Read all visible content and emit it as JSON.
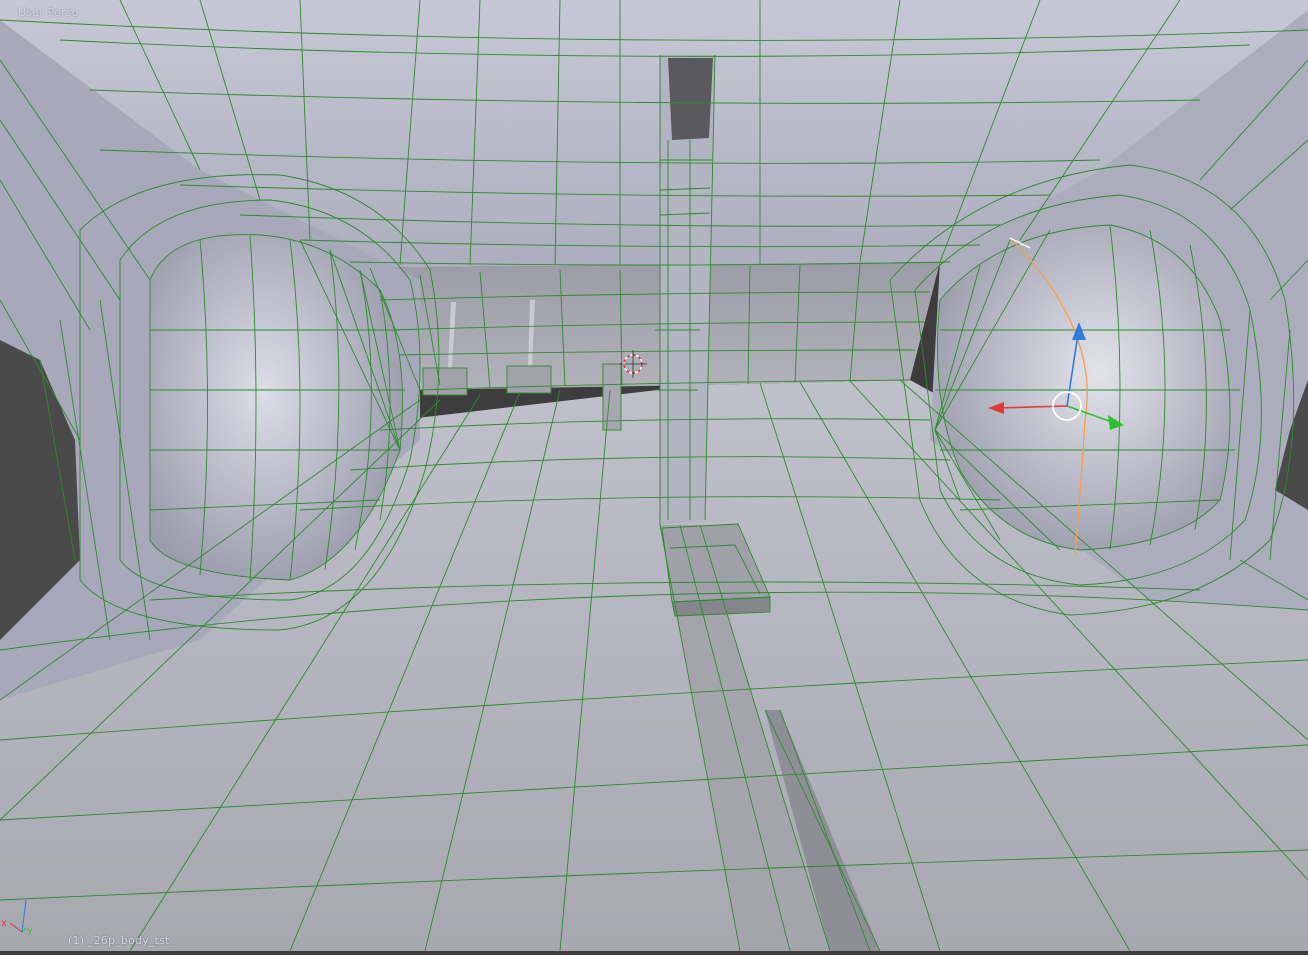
{
  "viewport": {
    "view_label": "User Persp",
    "object_label": "(1) _26p_body_tst",
    "axis_x": "x",
    "axis_y": "y"
  },
  "colors": {
    "mesh_face": "#b9bac6",
    "wireframe": "#2f8a2f",
    "background": "#3d3d3d",
    "axis_x": "#e03a3a",
    "axis_y": "#2fc02f",
    "axis_z": "#2f7de0",
    "selection": "#f0a050"
  },
  "icons": {
    "cursor": "3d-cursor-icon",
    "manipulator": "transform-manipulator-icon",
    "orientation": "axis-orientation-icon"
  }
}
